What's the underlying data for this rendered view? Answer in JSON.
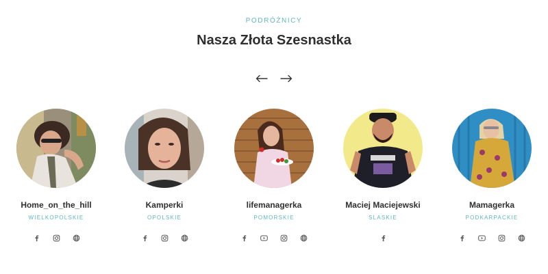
{
  "section": {
    "eyebrow": "PODRÓŻNICY",
    "title": "Nasza Złota Szesnastka"
  },
  "nav": {
    "prev_icon": "arrow-left-icon",
    "next_icon": "arrow-right-icon"
  },
  "colors": {
    "accent": "#5fb8c2",
    "text": "#2f2f2f",
    "icon": "#555555"
  },
  "travelers": [
    {
      "name": "Home_on_the_hill",
      "region": "WIELKOPOLSKIE",
      "socials": [
        "facebook-icon",
        "instagram-icon",
        "globe-icon"
      ]
    },
    {
      "name": "Kamperki",
      "region": "OPOLSKIE",
      "socials": [
        "facebook-icon",
        "instagram-icon",
        "globe-icon"
      ]
    },
    {
      "name": "lifemanagerka",
      "region": "POMORSKIE",
      "socials": [
        "facebook-icon",
        "youtube-icon",
        "instagram-icon",
        "globe-icon"
      ]
    },
    {
      "name": "Maciej Maciejewski",
      "region": "SLASKIE",
      "socials": [
        "facebook-icon"
      ]
    },
    {
      "name": "Mamagerka",
      "region": "PODKARPACKIE",
      "socials": [
        "facebook-icon",
        "youtube-icon",
        "instagram-icon",
        "globe-icon"
      ]
    }
  ]
}
